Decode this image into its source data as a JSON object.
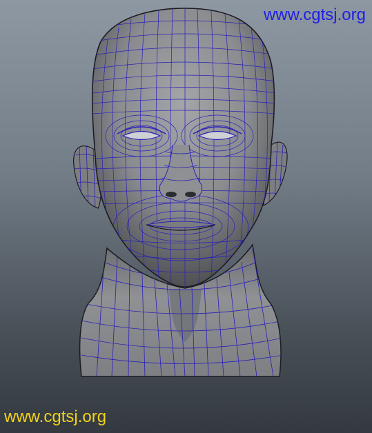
{
  "viewport": {
    "background": [
      "#8e98a2",
      "#33393f"
    ],
    "model": {
      "name": "head-mesh",
      "shading": "smooth-shade-with-wireframe",
      "wire_color": "#2a1fb8",
      "surface_color": "#8a8c90"
    }
  },
  "watermarks": {
    "top_text": "www.cgtsj.org",
    "top_color": "#1f1fe6",
    "bottom_text": "www.cgtsj.org",
    "bottom_color": "#f2d21a"
  }
}
